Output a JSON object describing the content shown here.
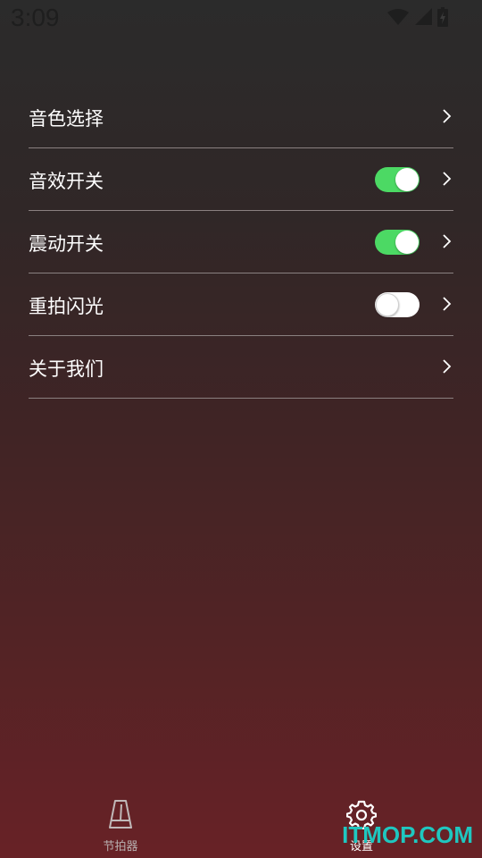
{
  "status_bar": {
    "time": "3:09",
    "icons": [
      "wifi-icon",
      "signal-icon",
      "battery-icon"
    ]
  },
  "settings": {
    "items": [
      {
        "label": "音色选择",
        "has_toggle": false
      },
      {
        "label": "音效开关",
        "has_toggle": true,
        "toggle_on": true
      },
      {
        "label": "震动开关",
        "has_toggle": true,
        "toggle_on": true
      },
      {
        "label": "重拍闪光",
        "has_toggle": true,
        "toggle_on": false
      },
      {
        "label": "关于我们",
        "has_toggle": false
      }
    ]
  },
  "bottom_nav": {
    "items": [
      {
        "label": "节拍器",
        "icon": "metronome-icon",
        "active": false
      },
      {
        "label": "设置",
        "icon": "gear-icon",
        "active": true
      }
    ]
  },
  "watermark": "ITMOP.COM",
  "colors": {
    "toggle_on": "#4cd964",
    "watermark": "#1fc7c0"
  }
}
